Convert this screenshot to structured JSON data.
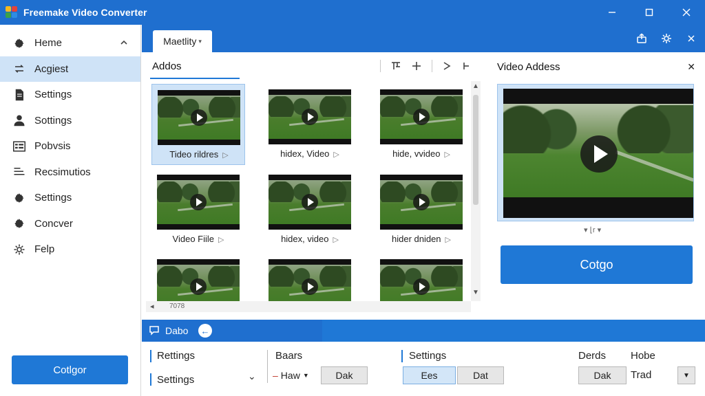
{
  "app": {
    "title": "Freemake Video Converter"
  },
  "window_controls": {
    "minimize": "minimize-icon",
    "maximize": "maximize-icon",
    "close": "close-icon"
  },
  "sidebar": {
    "items": [
      {
        "label": "Heme",
        "icon": "gear-icon"
      },
      {
        "label": "Acgiest",
        "icon": "arrows-icon"
      },
      {
        "label": "Settings",
        "icon": "document-icon"
      },
      {
        "label": "Sottings",
        "icon": "user-icon"
      },
      {
        "label": "Pobvsis",
        "icon": "list-icon"
      },
      {
        "label": "Recsimutios",
        "icon": "lines-icon"
      },
      {
        "label": "Settings",
        "icon": "gear-icon"
      },
      {
        "label": "Concver",
        "icon": "gear-icon"
      },
      {
        "label": "Felp",
        "icon": "gear-icon"
      }
    ],
    "convert_label": "Cotlgor"
  },
  "topstrip": {
    "tab_label": "Maetlity",
    "tab_caret": "▾"
  },
  "files_panel": {
    "title": "Addos",
    "thumbnails": [
      {
        "label": "Tideo rildres"
      },
      {
        "label": "hidex, Video"
      },
      {
        "label": "hide, vvideo"
      },
      {
        "label": "Video Fiile"
      },
      {
        "label": "hidex, video"
      },
      {
        "label": "hider dniden"
      },
      {
        "label": ""
      },
      {
        "label": ""
      },
      {
        "label": ""
      }
    ],
    "hscroll_label": "7078"
  },
  "preview": {
    "title": "Video Addess",
    "caption": "▾ ⌊r ▾",
    "convert_label": "Cotgo"
  },
  "bottom": {
    "tab_label": "Dabo",
    "col1": {
      "row1": "Rettings",
      "row2": "Settings"
    },
    "col2": {
      "heading": "Baars",
      "dropdown": "Haw",
      "button": "Dak"
    },
    "col3": {
      "heading": "Settings",
      "btn1": "Ees",
      "btn2": "Dat"
    },
    "col4": {
      "heading1": "Derds",
      "heading2": "Hobe",
      "button": "Dak",
      "value": "Trad"
    }
  },
  "colors": {
    "accent": "#1f6fcf",
    "button": "#1f78d6",
    "selection": "#cfe3f7"
  }
}
